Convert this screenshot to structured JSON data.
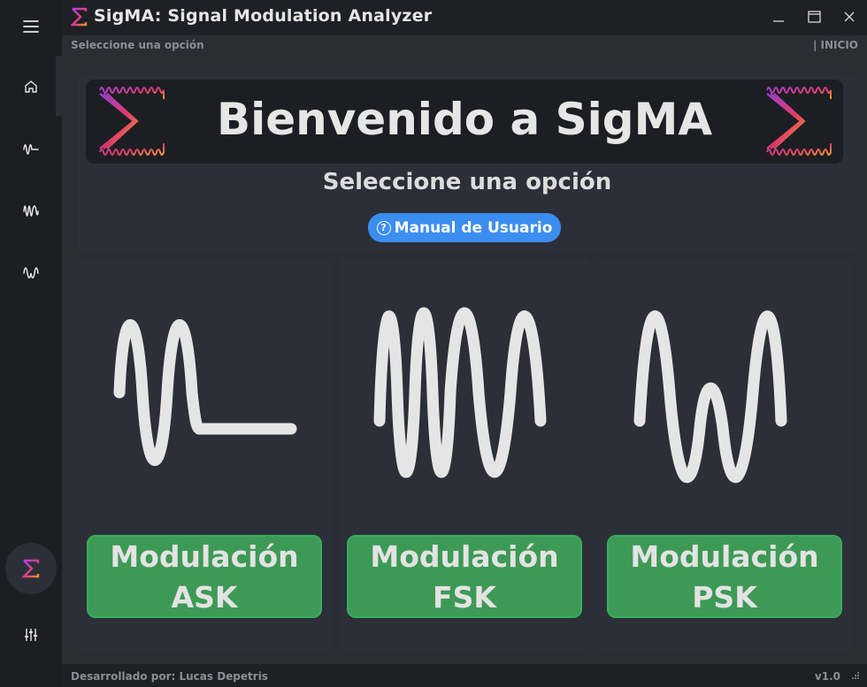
{
  "window": {
    "title": "SigMA: Signal Modulation Analyzer",
    "minimize_icon": "minimize-icon",
    "maximize_icon": "maximize-icon",
    "close_icon": "close-icon"
  },
  "sidebar": {
    "items": [
      {
        "name": "menu",
        "icon": "hamburger-menu-icon"
      },
      {
        "name": "home",
        "icon": "home-icon"
      },
      {
        "name": "ask",
        "icon": "ask-wave-icon"
      },
      {
        "name": "fsk",
        "icon": "fsk-wave-icon"
      },
      {
        "name": "psk",
        "icon": "psk-wave-icon"
      },
      {
        "name": "about",
        "icon": "sigma-icon"
      },
      {
        "name": "settings",
        "icon": "sliders-icon"
      }
    ]
  },
  "infobar": {
    "left": "Seleccione una opción",
    "right": "| INICIO"
  },
  "welcome": {
    "title": "Bienvenido a SigMA",
    "subtitle": "Seleccione una opción",
    "manual_button": "Manual de Usuario",
    "manual_icon": "?"
  },
  "cards": [
    {
      "line1": "Modulación",
      "line2": "ASK",
      "icon": "ask-wave-icon"
    },
    {
      "line1": "Modulación",
      "line2": "FSK",
      "icon": "fsk-wave-icon"
    },
    {
      "line1": "Modulación",
      "line2": "PSK",
      "icon": "psk-wave-icon"
    }
  ],
  "footer": {
    "left": "Desarrollado por: Lucas Depetris",
    "right": "v1.0"
  },
  "colors": {
    "accent_blue": "#3b8ef0",
    "button_green": "#3d9a56",
    "sidebar_bg": "#1c1e23",
    "content_bg": "#2a2d34",
    "card_bg": "#2c2f38",
    "sigma_gradient": [
      "#e0407a",
      "#f09030",
      "#a040e0"
    ]
  }
}
